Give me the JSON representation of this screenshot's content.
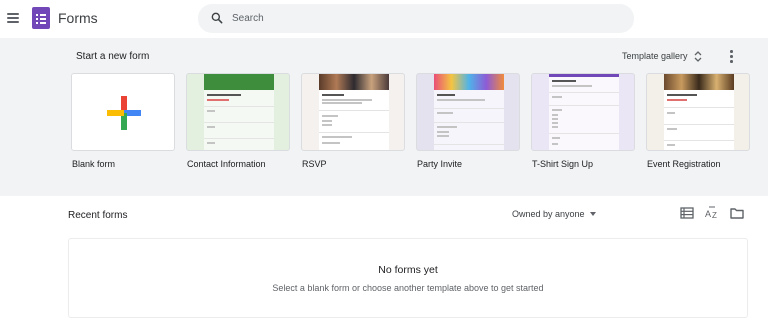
{
  "header": {
    "app_name": "Forms",
    "search": {
      "placeholder": "Search"
    }
  },
  "templates": {
    "section_label": "Start a new form",
    "gallery_label": "Template gallery",
    "items": [
      {
        "label": "Blank form"
      },
      {
        "label": "Contact Information"
      },
      {
        "label": "RSVP"
      },
      {
        "label": "Party Invite"
      },
      {
        "label": "T-Shirt Sign Up"
      },
      {
        "label": "Event Registration"
      }
    ]
  },
  "recent": {
    "title": "Recent forms",
    "owner_filter": "Owned by anyone",
    "empty_title": "No forms yet",
    "empty_subtitle": "Select a blank form or choose another template above to get started"
  },
  "colors": {
    "brand": "#7248b9",
    "plus_red": "#ea4335",
    "plus_blue": "#4285f4",
    "plus_yellow": "#fbbc04",
    "plus_green": "#34a853"
  },
  "icons": [
    "menu-icon",
    "forms-logo-icon",
    "search-icon",
    "unfold-icon",
    "more-vert-icon",
    "list-view-icon",
    "sort-az-icon",
    "folder-icon",
    "plus-icon"
  ]
}
